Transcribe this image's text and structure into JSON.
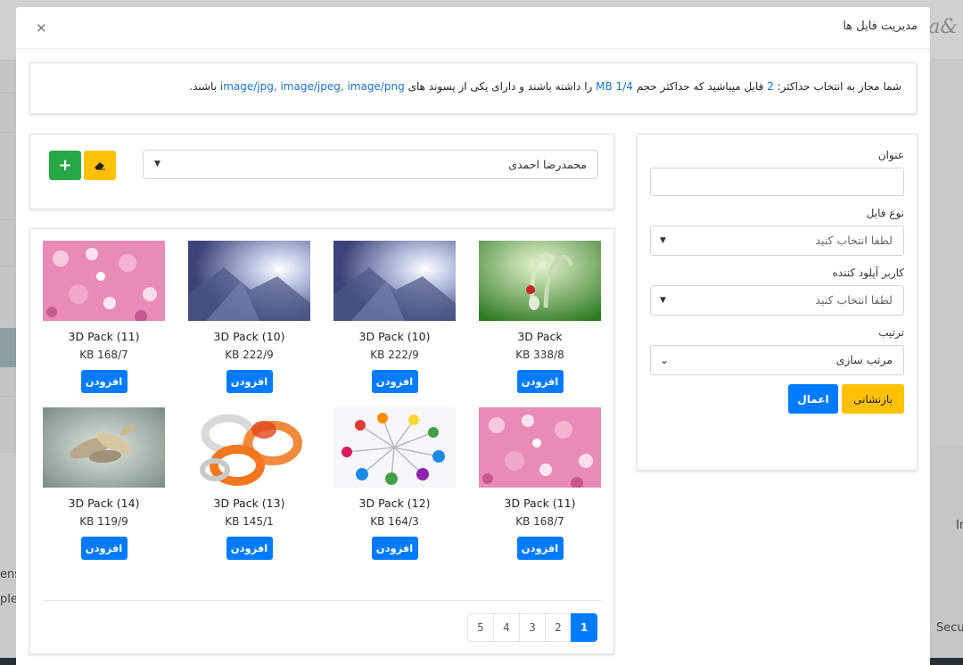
{
  "background": {
    "left_text_1": "ensu",
    "left_text_2": "plea",
    "right_text_1": "In",
    "right_text_2": "Secu"
  },
  "modal": {
    "title": "مدیریت فایل ها",
    "close_label": "×"
  },
  "notice": {
    "part1": "شما مجاز به انتخاب حداکثر: ",
    "max_files": "2",
    "part2": " فایل میباشید که حداکثر حجم ",
    "max_size": "MB 1/4",
    "part3": " را داشته باشند و دارای یکی از پسوند های ",
    "extensions": "image/jpg, image/jpeg, image/png",
    "part4": " باشند."
  },
  "filter": {
    "title_label": "عنوان",
    "title_value": "",
    "file_type_label": "نوع فایل",
    "file_type_value": "لطفا انتخاب کنید",
    "uploader_label": "کاربر آپلود کننده",
    "uploader_value": "لطفا انتخاب کنید",
    "sort_label": "ترتیب",
    "sort_value": "مرتب سازی",
    "reset_label": "بازنشانی",
    "apply_label": "اعمال"
  },
  "uploader": {
    "selected_user": "محمدرضا احمدی",
    "add_icon": "+"
  },
  "gallery": {
    "add_label": "افزودن",
    "items": [
      {
        "name": "3D Pack",
        "size": "KB 338/8",
        "thumb": "candy-cane-green"
      },
      {
        "name": "3D Pack (10)",
        "size": "KB 222/9",
        "thumb": "abstract-blue-light"
      },
      {
        "name": "3D Pack (10)",
        "size": "KB 222/9",
        "thumb": "abstract-blue-light"
      },
      {
        "name": "3D Pack (11)",
        "size": "KB 168/7",
        "thumb": "pink-crystals"
      },
      {
        "name": "3D Pack (11)",
        "size": "KB 168/7",
        "thumb": "pink-crystals"
      },
      {
        "name": "3D Pack (12)",
        "size": "KB 164/3",
        "thumb": "colored-pins"
      },
      {
        "name": "3D Pack (13)",
        "size": "KB 145/1",
        "thumb": "orange-glass-rings"
      },
      {
        "name": "3D Pack (14)",
        "size": "KB 119/9",
        "thumb": "metal-leaves"
      }
    ],
    "pages": [
      "5",
      "4",
      "3",
      "2",
      "1"
    ],
    "active_page": "1"
  },
  "colors": {
    "primary": "#007bff",
    "success": "#28a745",
    "warning": "#ffc107",
    "link": "#1a73c8"
  }
}
